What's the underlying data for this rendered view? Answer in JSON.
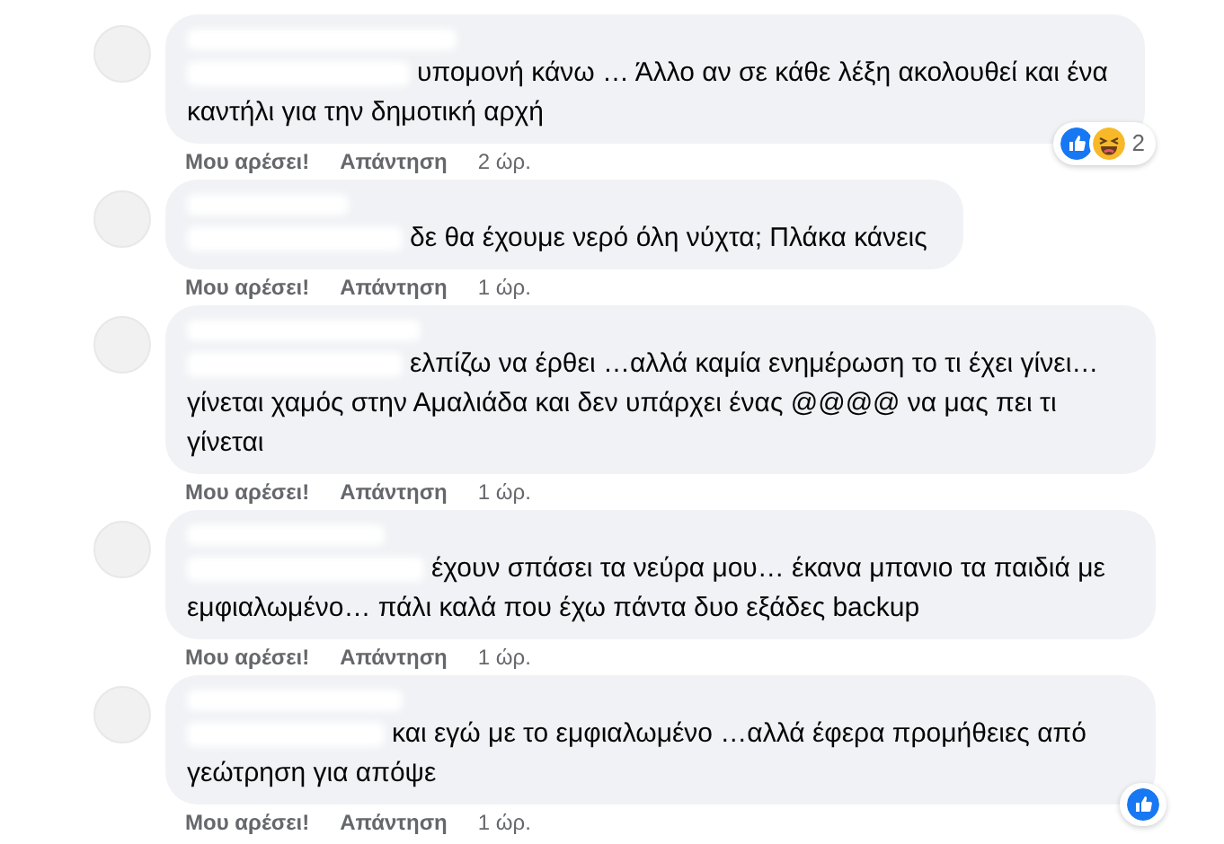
{
  "comments": [
    {
      "text": "υπομονή κάνω … Άλλο αν σε κάθε λέξη ακολουθεί και ένα καντήλι για την δημοτική αρχή",
      "like": "Μου αρέσει!",
      "reply": "Απάντηση",
      "time": "2 ώρ.",
      "reactions": [
        {
          "kind": "like"
        },
        {
          "kind": "haha"
        }
      ],
      "reaction_count": "2"
    },
    {
      "text": "δε θα έχουμε νερό όλη νύχτα; Πλάκα κάνεις",
      "like": "Μου αρέσει!",
      "reply": "Απάντηση",
      "time": "1 ώρ."
    },
    {
      "text": "ελπίζω να έρθει …αλλά καμία ενημέρωση το τι έχει γίνει…γίνεται χαμός στην Αμαλιάδα και δεν υπάρχει ένας @@@@ να μας πει τι γίνεται",
      "like": "Μου αρέσει!",
      "reply": "Απάντηση",
      "time": "1 ώρ."
    },
    {
      "text": "έχουν σπάσει τα νεύρα μου… έκανα μπανιο τα παιδιά με εμφιαλωμένο… πάλι καλά που έχω πάντα δυο εξάδες backup",
      "like": "Μου αρέσει!",
      "reply": "Απάντηση",
      "time": "1 ώρ."
    },
    {
      "text": "και εγώ με το εμφιαλωμένο …αλλά έφερα προμήθειες από γεώτρηση για απόψε",
      "like": "Μου αρέσει!",
      "reply": "Απάντηση",
      "time": "1 ώρ.",
      "reactions": [
        {
          "kind": "like"
        }
      ]
    }
  ]
}
